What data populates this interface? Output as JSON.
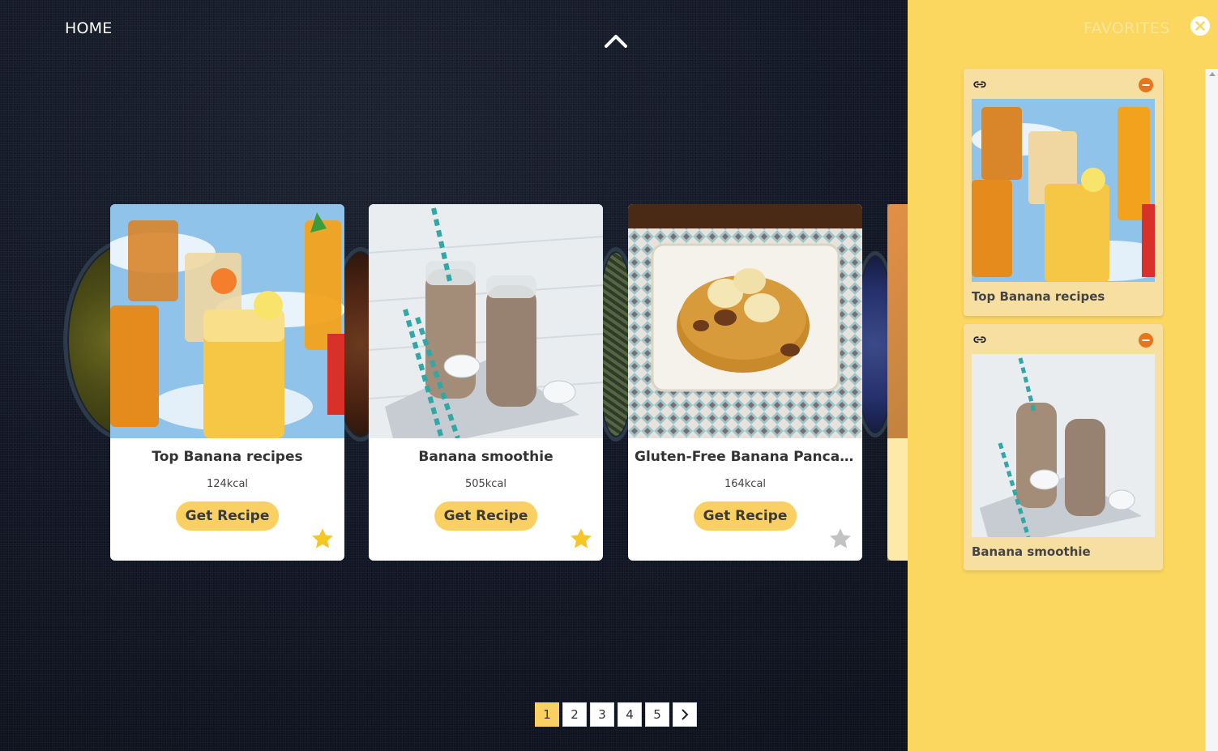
{
  "nav": {
    "home_label": "HOME",
    "up_icon": "chevron-up-icon"
  },
  "cards": [
    {
      "title": "Top Banana recipes",
      "kcal": "124kcal",
      "button_label": "Get Recipe",
      "favorited": true
    },
    {
      "title": "Banana smoothie",
      "kcal": "505kcal",
      "button_label": "Get Recipe",
      "favorited": true
    },
    {
      "title": "Gluten-Free Banana Pancakes",
      "kcal": "164kcal",
      "button_label": "Get Recipe",
      "favorited": false
    }
  ],
  "pagination": {
    "pages": [
      "1",
      "2",
      "3",
      "4",
      "5"
    ],
    "active": "1",
    "next_icon": "chevron-right-icon"
  },
  "favorites": {
    "heading": "FAVORITES",
    "close_icon": "close-icon",
    "items": [
      {
        "title": "Top Banana recipes",
        "link_icon": "link-icon",
        "remove_icon": "remove-icon"
      },
      {
        "title": "Banana smoothie",
        "link_icon": "link-icon",
        "remove_icon": "remove-icon"
      }
    ]
  },
  "colors": {
    "accent_yellow": "#fbd063",
    "panel_yellow": "#fbd760",
    "star_active": "#f6c526",
    "star_inactive": "#c2c2c2",
    "remove_orange": "#e5761e"
  }
}
